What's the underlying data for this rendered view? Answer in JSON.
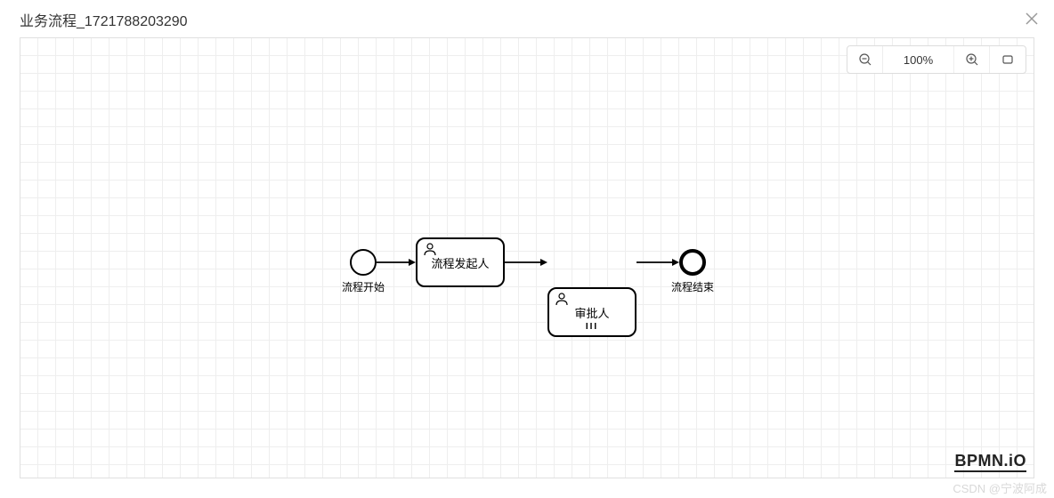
{
  "header": {
    "title": "业务流程_1721788203290"
  },
  "toolbar": {
    "zoom_level": "100%",
    "zoom_out_icon": "zoom-out",
    "zoom_in_icon": "zoom-in",
    "fit_icon": "fit-viewport"
  },
  "diagram": {
    "start_event": {
      "label": "流程开始"
    },
    "task1": {
      "label": "流程发起人",
      "type": "userTask"
    },
    "task2": {
      "label": "审批人",
      "type": "userTask",
      "multi_instance": true
    },
    "end_event": {
      "label": "流程结束"
    }
  },
  "branding": {
    "logo": "BPMN.iO"
  },
  "watermark": "CSDN @宁波阿成"
}
